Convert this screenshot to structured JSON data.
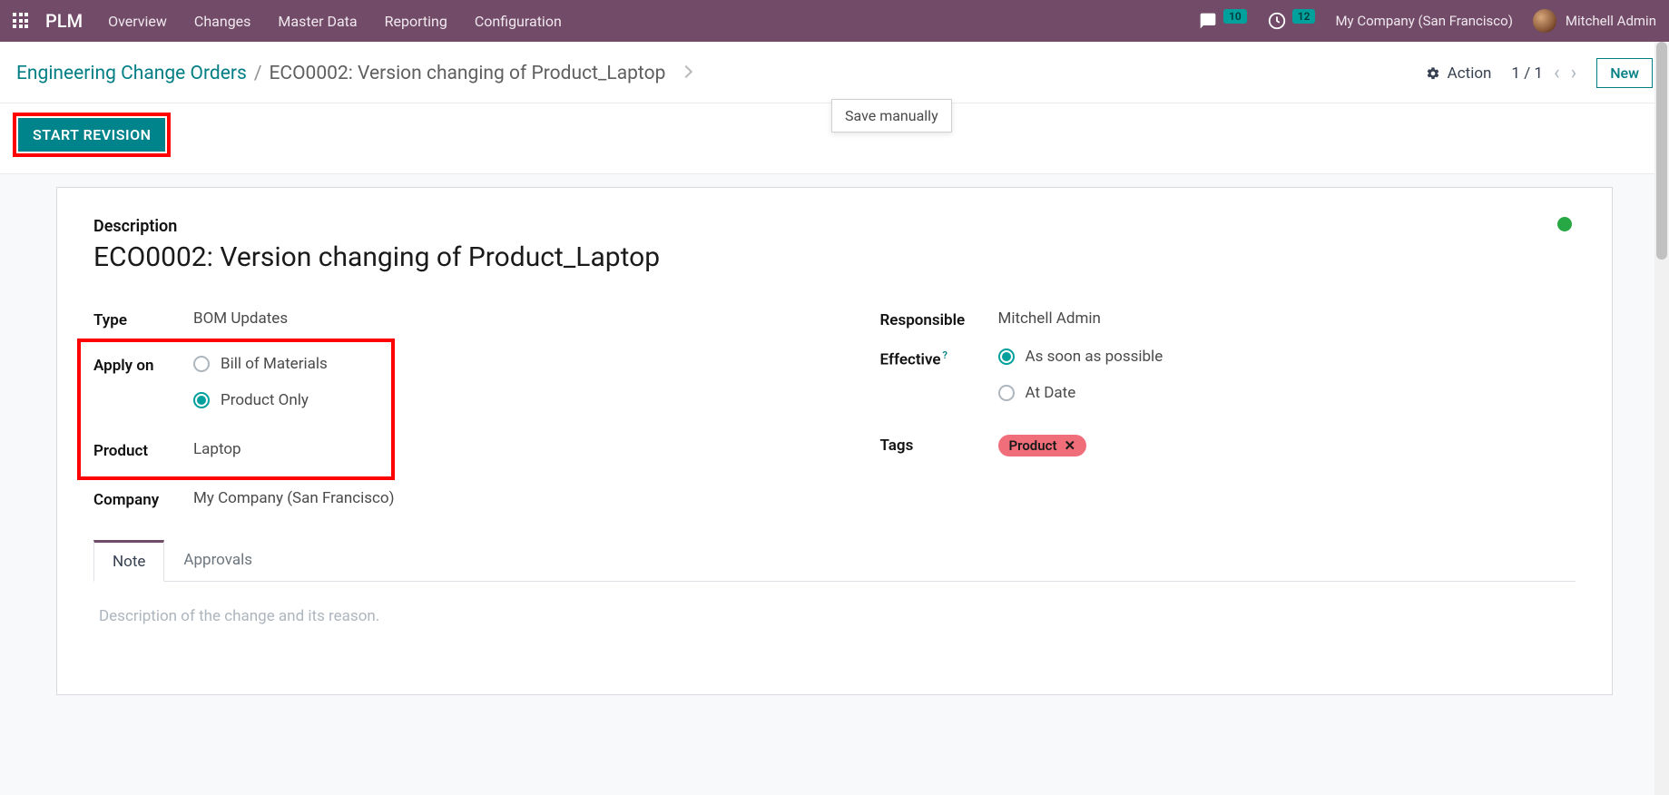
{
  "navbar": {
    "app_name": "PLM",
    "menu": [
      "Overview",
      "Changes",
      "Master Data",
      "Reporting",
      "Configuration"
    ],
    "messages_count": "10",
    "activities_count": "12",
    "company": "My Company (San Francisco)",
    "user": "Mitchell Admin"
  },
  "breadcrumb": {
    "root": "Engineering Change Orders",
    "current": "ECO0002: Version changing of Product_Laptop"
  },
  "toolbar": {
    "action_label": "Action",
    "pager": "1 / 1",
    "new_label": "New",
    "tooltip": "Save manually",
    "start_revision": "START REVISION"
  },
  "form": {
    "description_label": "Description",
    "title": "ECO0002: Version changing of Product_Laptop",
    "left": {
      "type_label": "Type",
      "type_value": "BOM Updates",
      "apply_on_label": "Apply on",
      "apply_on_options": [
        "Bill of Materials",
        "Product Only"
      ],
      "apply_on_selected": 1,
      "product_label": "Product",
      "product_value": "Laptop",
      "company_label": "Company",
      "company_value": "My Company (San Francisco)"
    },
    "right": {
      "responsible_label": "Responsible",
      "responsible_value": "Mitchell Admin",
      "effective_label": "Effective",
      "effective_options": [
        "As soon as possible",
        "At Date"
      ],
      "effective_selected": 0,
      "tags_label": "Tags",
      "tags": [
        "Product"
      ]
    },
    "tabs": [
      "Note",
      "Approvals"
    ],
    "active_tab": 0,
    "note_placeholder": "Description of the change and its reason."
  }
}
